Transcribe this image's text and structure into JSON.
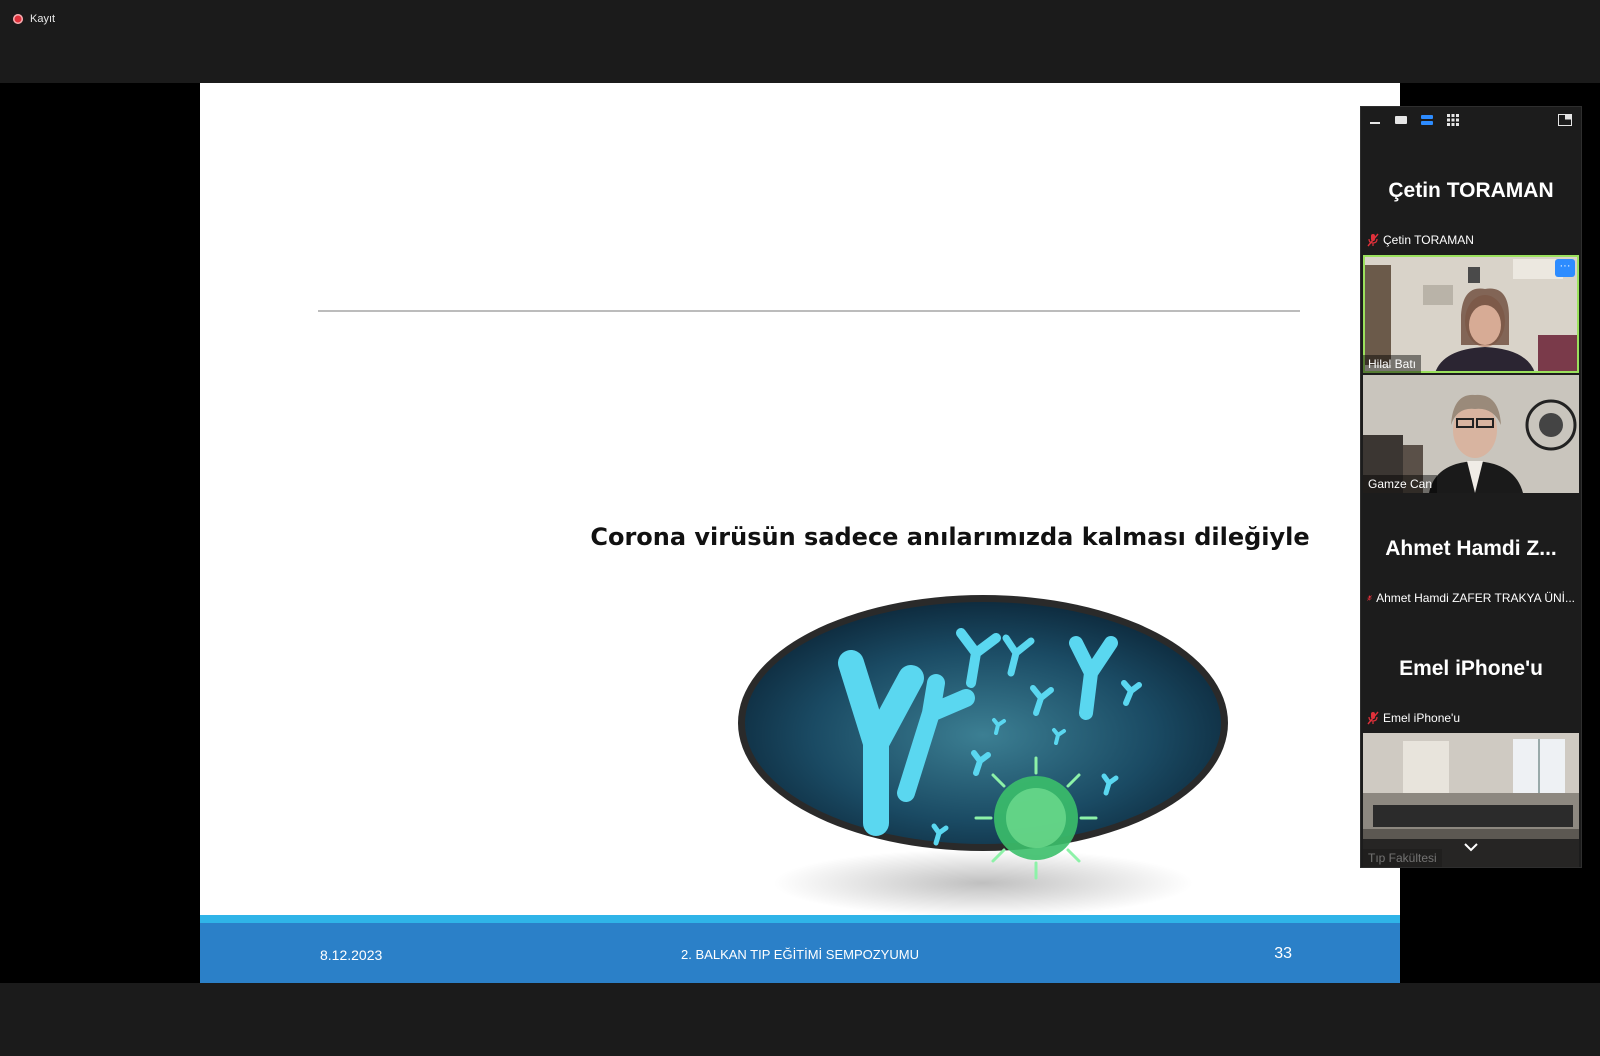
{
  "recording": {
    "label": "Kayıt"
  },
  "slide": {
    "message": "Corona virüsün sadece anılarımızda kalması dileğiyle",
    "image_icon": "antibody-virus-image",
    "footer": {
      "date": "8.12.2023",
      "event": "2. BALKAN TIP EĞİTİMİ SEMPOZYUMU",
      "page_number": "33"
    }
  },
  "participants_panel": {
    "toolbar_icons": [
      "minimize-icon",
      "speaker-view-icon",
      "strip-view-icon",
      "gallery-view-icon",
      "pop-out-icon"
    ],
    "participants": [
      {
        "big_name": "Çetin TORAMAN",
        "label": "Çetin TORAMAN",
        "muted": true,
        "video": false
      },
      {
        "label": "Hilal Batı",
        "video": true,
        "active": true
      },
      {
        "label": "Gamze Can",
        "video": true
      },
      {
        "big_name": "Ahmet Hamdi Z...",
        "label": "Ahmet Hamdi ZAFER TRAKYA ÜNİ...",
        "muted": true,
        "video": false
      },
      {
        "big_name": "Emel iPhone'u",
        "label": "Emel iPhone'u",
        "muted": true,
        "video": false
      },
      {
        "label": "Tıp Fakültesi",
        "video": true,
        "muted": true
      }
    ],
    "more_button": "···"
  },
  "colors": {
    "footer_blue": "#2b80c8",
    "stripe": "#2fb4e8",
    "active_border": "#9be15d",
    "zoom_blue": "#2d8cff"
  }
}
